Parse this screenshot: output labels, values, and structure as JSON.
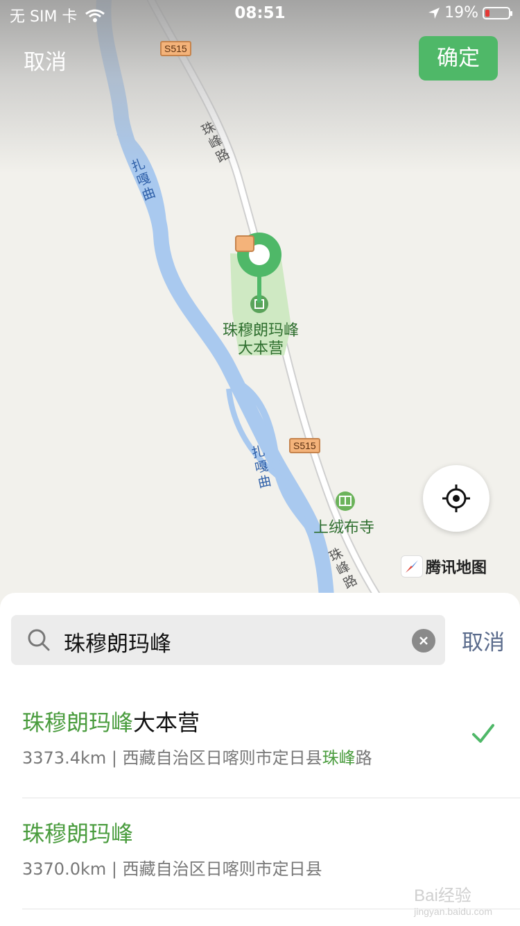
{
  "status_bar": {
    "carrier": "无 SIM 卡",
    "time": "08:51",
    "battery": "19%",
    "battery_level": 0.19
  },
  "header": {
    "cancel_label": "取消",
    "confirm_label": "确定"
  },
  "map": {
    "road_shield_labels": [
      "S515",
      "S515"
    ],
    "road_name": "珠峰路",
    "river_name": "扎嘎曲",
    "poi_main": [
      "珠穆朗玛峰",
      "大本营"
    ],
    "poi_temple": "上绒布寺",
    "brand": "腾讯地图",
    "colors": {
      "water": "#a9c9ef",
      "road": "#ffffff",
      "park": "#cfe9c3",
      "pin": "#4fb868"
    }
  },
  "search": {
    "query": "珠穆朗玛峰",
    "cancel_label": "取消"
  },
  "results": [
    {
      "name_highlight": "珠穆朗玛峰",
      "name_rest": "大本营",
      "distance": "3373.4km",
      "separator": " | ",
      "addr_prefix": "西藏自治区日喀则市定日县",
      "addr_highlight": "珠峰",
      "addr_suffix": "路",
      "selected": true
    },
    {
      "name_highlight": "珠穆朗玛峰",
      "name_rest": "",
      "distance": "3370.0km",
      "separator": " | ",
      "addr_prefix": "西藏自治区日喀则市定日县",
      "addr_highlight": "",
      "addr_suffix": "",
      "selected": false
    }
  ],
  "watermark": {
    "text": "Bai经验",
    "sub": "jingyan.baidu.com"
  }
}
